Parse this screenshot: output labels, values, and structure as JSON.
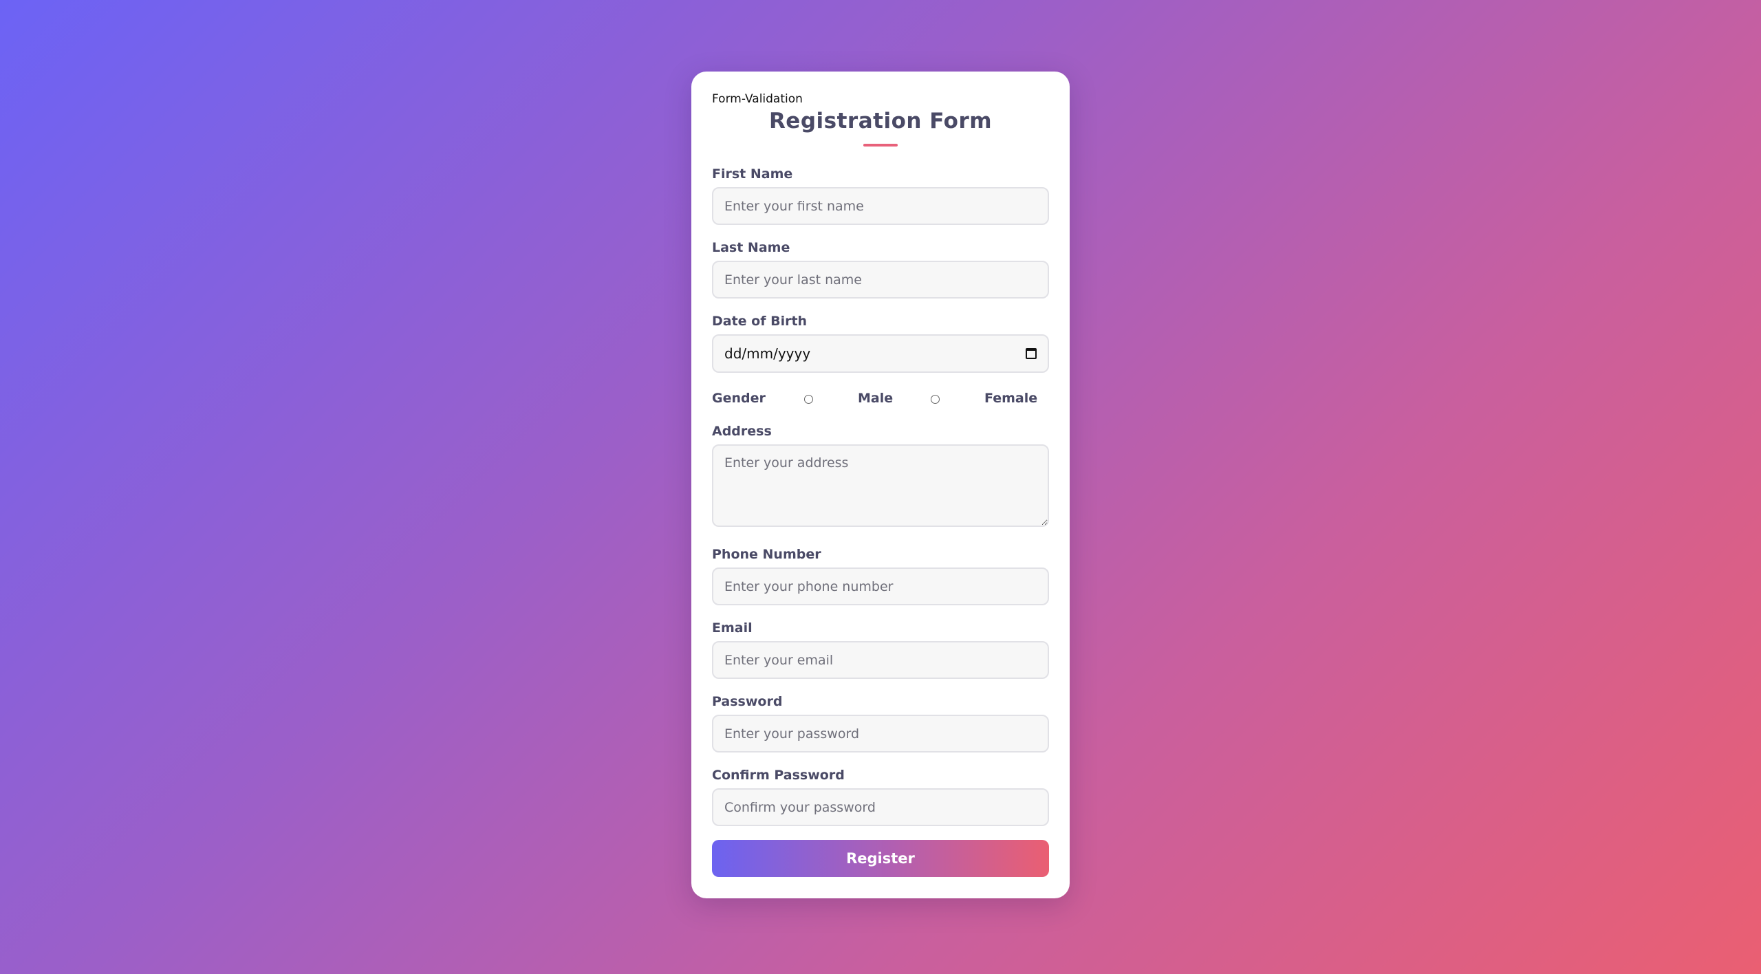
{
  "app": {
    "title": "Form-Validation"
  },
  "form": {
    "title": "Registration Form",
    "first_name": {
      "label": "First Name",
      "placeholder": "Enter your first name"
    },
    "last_name": {
      "label": "Last Name",
      "placeholder": "Enter your last name"
    },
    "dob": {
      "label": "Date of Birth",
      "value": "dd/mm/yyyy"
    },
    "gender": {
      "label": "Gender",
      "options": [
        "Male",
        "Female"
      ]
    },
    "address": {
      "label": "Address",
      "placeholder": "Enter your address"
    },
    "phone": {
      "label": "Phone Number",
      "placeholder": "Enter your phone number"
    },
    "email": {
      "label": "Email",
      "placeholder": "Enter your email"
    },
    "password": {
      "label": "Password",
      "placeholder": "Enter your password"
    },
    "confirm_password": {
      "label": "Confirm Password",
      "placeholder": "Confirm your password"
    },
    "submit_label": "Register"
  },
  "colors": {
    "accent_pink": "#e8617a",
    "accent_purple": "#6c63f0",
    "label_text": "#4a4a66",
    "input_bg": "#f7f7f7"
  },
  "icons": {
    "date_field": "calendar-icon",
    "address_field": "resize-handle-icon"
  }
}
